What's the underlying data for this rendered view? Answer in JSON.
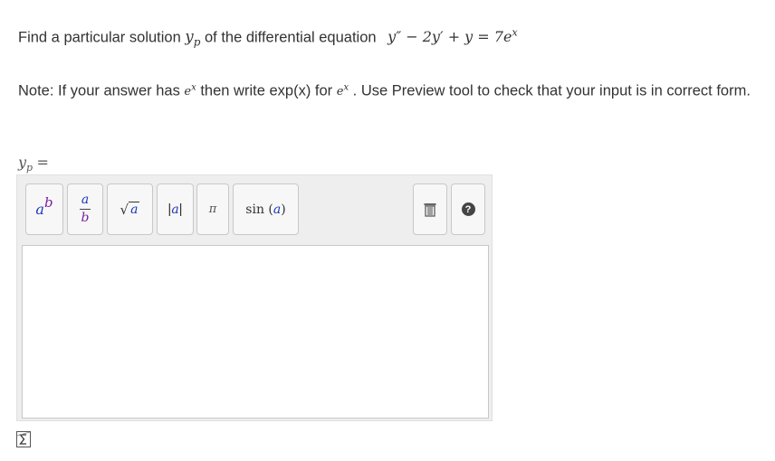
{
  "question": {
    "prompt": "Find  a particular solution",
    "var": "y",
    "var_sub": "p",
    "mid": "of the differential equation",
    "equation": "y″ − 2y′ + y = 7e",
    "equation_sup": "x"
  },
  "note": {
    "part1": "Note: If your answer has ",
    "e1": "e",
    "e1_sup": "x",
    "part2": " then write exp(x) for ",
    "e2": "e",
    "e2_sup": "x",
    "part3": " . Use Preview tool to check that your input is in correct form."
  },
  "answer": {
    "var": "y",
    "var_sub": "p",
    "equals": "="
  },
  "toolbar": {
    "power": {
      "base": "a",
      "exp": "b"
    },
    "fraction": {
      "num": "a",
      "den": "b"
    },
    "sqrt": {
      "radical": "√",
      "arg": "a"
    },
    "abs": {
      "bar": "|",
      "arg": "a"
    },
    "pi": "π",
    "sin": {
      "fn": "sin",
      "open": "(",
      "arg": "a",
      "close": ")"
    },
    "help": "?"
  }
}
